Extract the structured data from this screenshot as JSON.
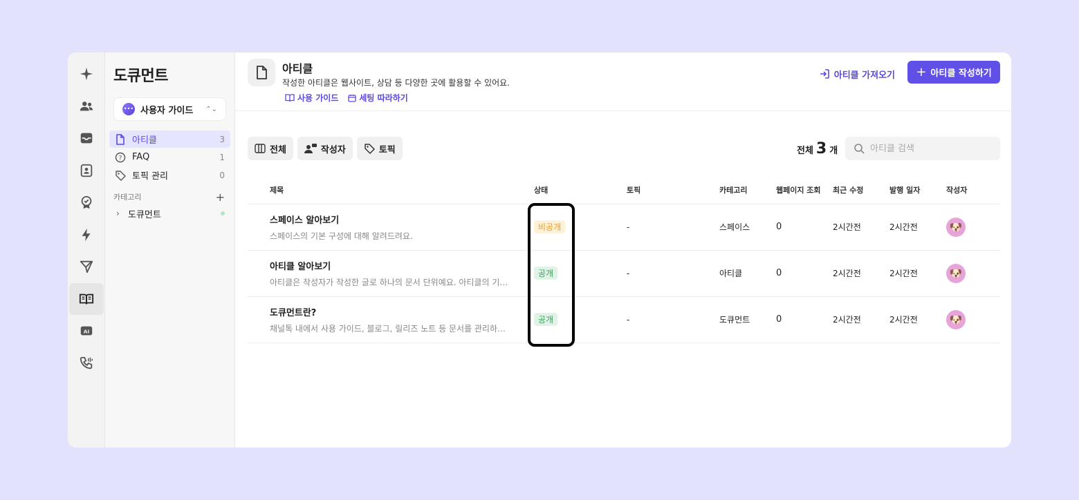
{
  "sidebar": {
    "title": "도큐먼트"
  },
  "space_select": {
    "label": "사용자 가이드"
  },
  "nav": [
    {
      "label": "아티클",
      "count": "3"
    },
    {
      "label": "FAQ",
      "count": "1"
    },
    {
      "label": "토픽 관리",
      "count": "0"
    }
  ],
  "category": {
    "header": "카테고리",
    "item": "도큐먼트"
  },
  "header": {
    "title": "아티클",
    "desc": "작성한 아티클은 웹사이트, 상담 등 다양한 곳에 활용할 수 있어요.",
    "guide_link": "사용 가이드",
    "setting_link": "세팅 따라하기",
    "import_button": "아티클 가져오기",
    "write_button": "아티클 작성하기"
  },
  "filters": {
    "all": "전체",
    "author": "작성자",
    "topic": "토픽"
  },
  "total": {
    "prefix": "전체",
    "count": "3",
    "suffix": "개"
  },
  "search": {
    "placeholder": "아티클 검색"
  },
  "table": {
    "headers": {
      "title": "제목",
      "status": "상태",
      "topic": "토픽",
      "category": "카테고리",
      "views": "웹페이지 조회",
      "modified": "최근 수정",
      "published": "발행 일자",
      "author": "작성자"
    },
    "rows": [
      {
        "title": "스페이스 알아보기",
        "desc": "스페이스의 기본 구성에 대해 알려드려요.",
        "status": "비공개",
        "topic": "-",
        "category": "스페이스",
        "views": "0",
        "modified": "2시간전",
        "published": "2시간전"
      },
      {
        "title": "아티클 알아보기",
        "desc": "아티클은 작성자가 작성한 글로 하나의 문서 단위예요. 아티클의 기…",
        "status": "공개",
        "topic": "-",
        "category": "아티클",
        "views": "0",
        "modified": "2시간전",
        "published": "2시간전"
      },
      {
        "title": "도큐먼트란?",
        "desc": "채널톡 내에서 사용 가이드, 블로그, 릴리즈 노트 등 문서를 관리하…",
        "status": "공개",
        "topic": "-",
        "category": "도큐먼트",
        "views": "0",
        "modified": "2시간전",
        "published": "2시간전"
      }
    ]
  },
  "colors": {
    "accent": "#6150e8",
    "background": "#e3e2fd",
    "private": "#e5a02a",
    "public": "#3a9d5d"
  }
}
